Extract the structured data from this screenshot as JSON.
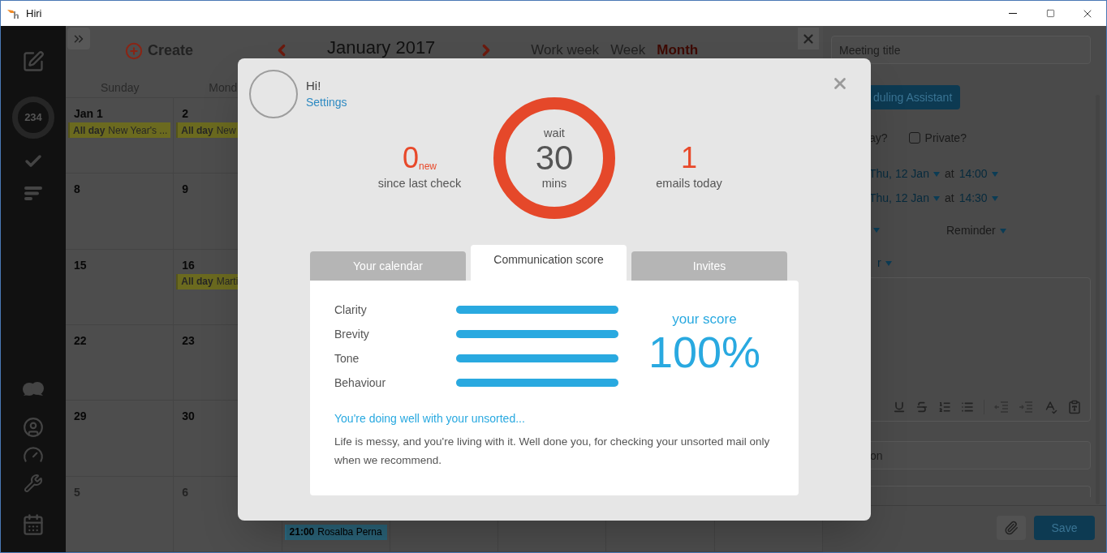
{
  "window": {
    "title": "Hiri"
  },
  "sidebar": {
    "unread_count": "234"
  },
  "calendar": {
    "create": "Create",
    "month": "January 2017",
    "views": [
      {
        "label": "Work week",
        "selected": false
      },
      {
        "label": "Week",
        "selected": false
      },
      {
        "label": "Month",
        "selected": true
      }
    ],
    "weekdays": [
      "Sunday",
      "Mond"
    ],
    "weeks": [
      {
        "days": [
          {
            "date": "Jan 1",
            "muted": false,
            "events": [
              {
                "kind": "all_day",
                "label": "All day",
                "title": "New Year's ...",
                "color": "#6b6a1f"
              }
            ]
          },
          {
            "date": "2",
            "muted": false,
            "events": [
              {
                "kind": "all_day",
                "label": "All day",
                "title": "New",
                "color": "#6b6a1f"
              }
            ]
          }
        ]
      },
      {
        "days": [
          {
            "date": "8",
            "muted": false
          },
          {
            "date": "9",
            "muted": false
          }
        ]
      },
      {
        "days": [
          {
            "date": "15",
            "muted": false
          },
          {
            "date": "16",
            "muted": false,
            "events": [
              {
                "kind": "all_day",
                "label": "All day",
                "title": "Marti",
                "color": "#6b6a1f"
              }
            ]
          }
        ]
      },
      {
        "days": [
          {
            "date": "22",
            "muted": false
          },
          {
            "date": "23",
            "muted": false
          }
        ]
      },
      {
        "days": [
          {
            "date": "29",
            "muted": false
          },
          {
            "date": "30",
            "muted": false
          }
        ]
      },
      {
        "days": [
          {
            "date": "5",
            "muted": true
          },
          {
            "date": "6",
            "muted": true
          },
          {
            "events": [
              {
                "kind": "timed",
                "time": "21:00",
                "title": "Rosalba Perna",
                "color": "#2a6378"
              }
            ]
          }
        ]
      }
    ]
  },
  "event_form": {
    "title_placeholder": "Meeting title",
    "assistant_button": "duling Assistant",
    "all_day_label": "ay?",
    "private": {
      "label": "Private?",
      "checked": false
    },
    "start": {
      "date": "Thu, 12 Jan",
      "at": "at",
      "time": "14:00"
    },
    "end": {
      "date": "Thu, 12 Jan",
      "at": "at",
      "time": "14:30"
    },
    "reminder": "Reminder",
    "calendar_dropdown": "r",
    "location_placeholder": "on",
    "save": "Save"
  },
  "dialog": {
    "greeting": "Hi!",
    "settings_link": "Settings",
    "new_count": "0",
    "new_label": "new",
    "since_label": "since last check",
    "wait_label": "wait",
    "wait_value": "30",
    "wait_unit": "mins",
    "emails_count": "1",
    "emails_label": "emails today",
    "tabs": [
      {
        "label": "Your calendar",
        "selected": false
      },
      {
        "label": "Communication score",
        "selected": true
      },
      {
        "label": "Invites",
        "selected": false
      }
    ],
    "metrics": [
      {
        "name": "Clarity",
        "level": 1
      },
      {
        "name": "Brevity",
        "level": 1
      },
      {
        "name": "Tone",
        "level": 1
      },
      {
        "name": "Behaviour",
        "level": 1
      }
    ],
    "score_label": "your score",
    "score_value": "100%",
    "message_title": "You're doing well with your unsorted...",
    "message_body": "Life is messy, and you're living with it.  Well done you, for checking your unsorted mail only when we recommend."
  }
}
